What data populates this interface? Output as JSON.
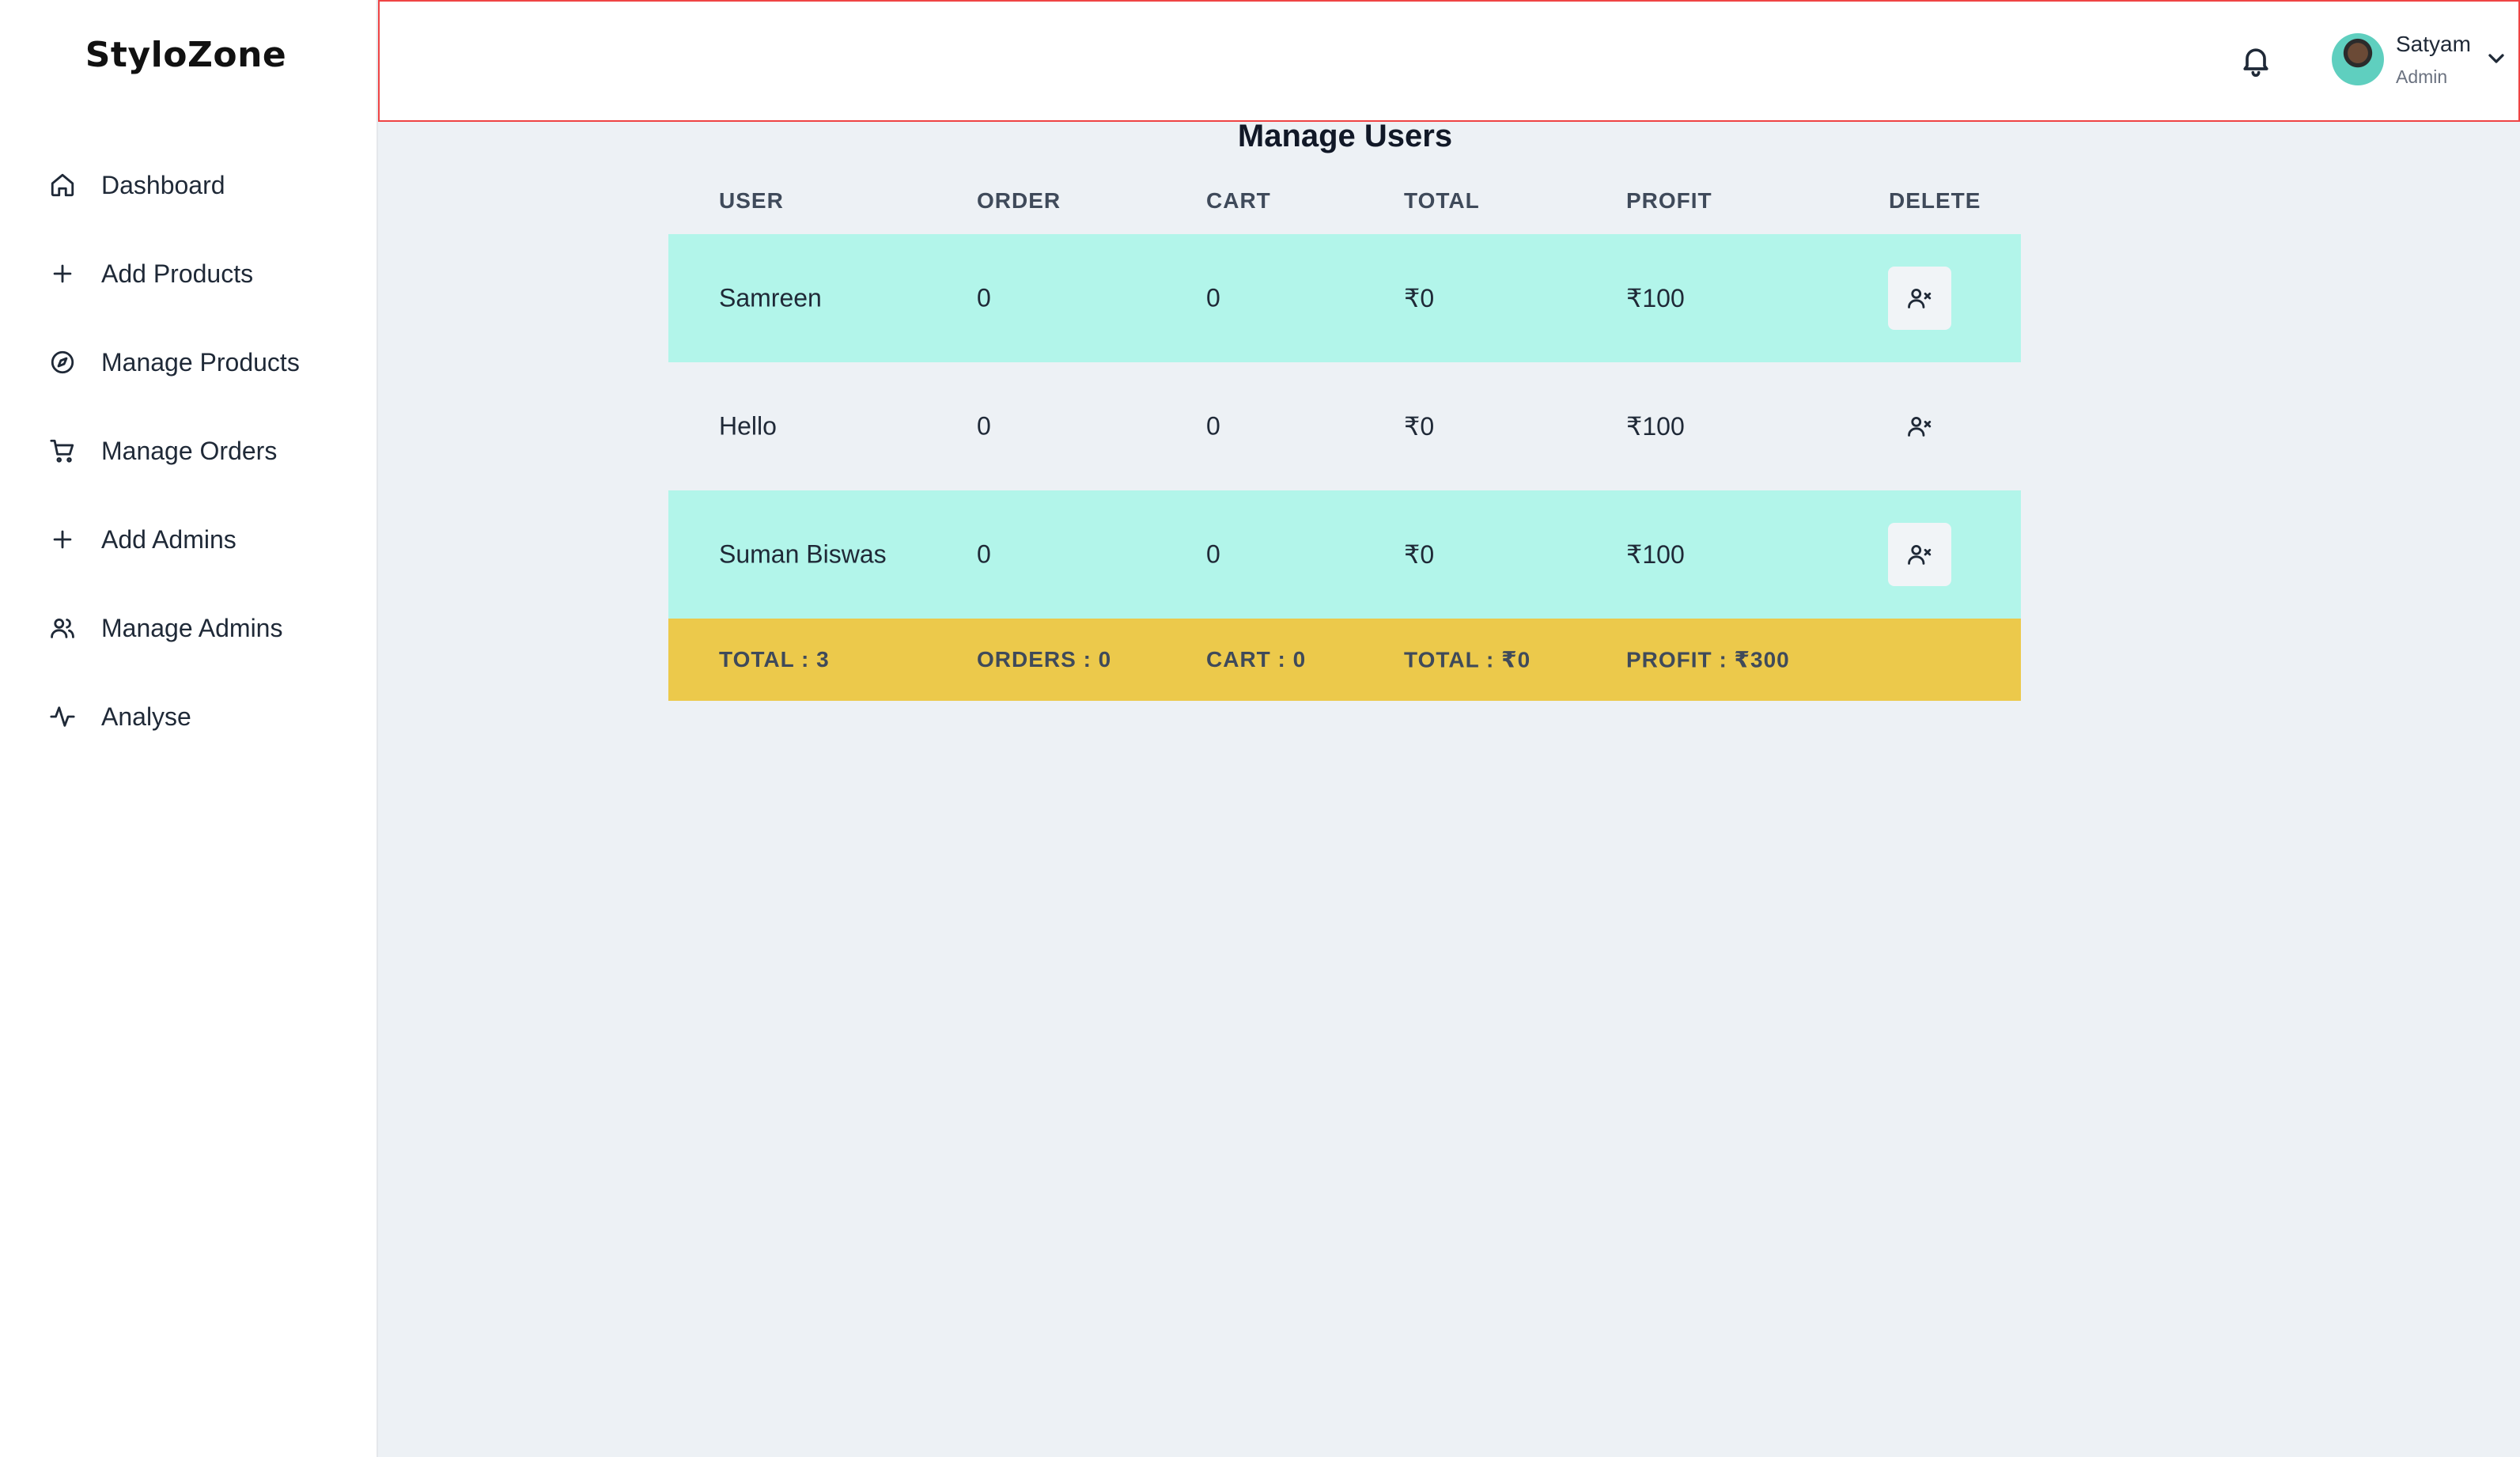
{
  "app": {
    "logo": "StyloZone"
  },
  "sidebar": {
    "items": [
      {
        "label": "Dashboard",
        "icon": "home-icon"
      },
      {
        "label": "Add Products",
        "icon": "plus-icon"
      },
      {
        "label": "Manage Products",
        "icon": "compass-icon"
      },
      {
        "label": "Manage Orders",
        "icon": "cart-icon"
      },
      {
        "label": "Add Admins",
        "icon": "plus-icon"
      },
      {
        "label": "Manage Admins",
        "icon": "users-icon"
      },
      {
        "label": "Analyse",
        "icon": "activity-icon"
      }
    ]
  },
  "header": {
    "user": {
      "name": "Satyam",
      "role": "Admin"
    }
  },
  "main": {
    "title": "Manage Users",
    "columns": [
      "USER",
      "ORDER",
      "CART",
      "TOTAL",
      "PROFIT",
      "DELETE"
    ],
    "rows": [
      {
        "user": "Samreen",
        "order": "0",
        "cart": "0",
        "total": "₹0",
        "profit": "₹100"
      },
      {
        "user": "Hello",
        "order": "0",
        "cart": "0",
        "total": "₹0",
        "profit": "₹100"
      },
      {
        "user": "Suman Biswas",
        "order": "0",
        "cart": "0",
        "total": "₹0",
        "profit": "₹100"
      }
    ],
    "totals": {
      "users": "TOTAL : 3",
      "orders": "ORDERS : 0",
      "cart": "CART : 0",
      "total": "TOTAL : ₹0",
      "profit": "PROFIT : ₹300"
    }
  },
  "colors": {
    "row_highlight": "#b2f5ea",
    "totals_bar": "#ecc94b",
    "header_border": "#ef4444",
    "page_background": "#edf1f5"
  }
}
